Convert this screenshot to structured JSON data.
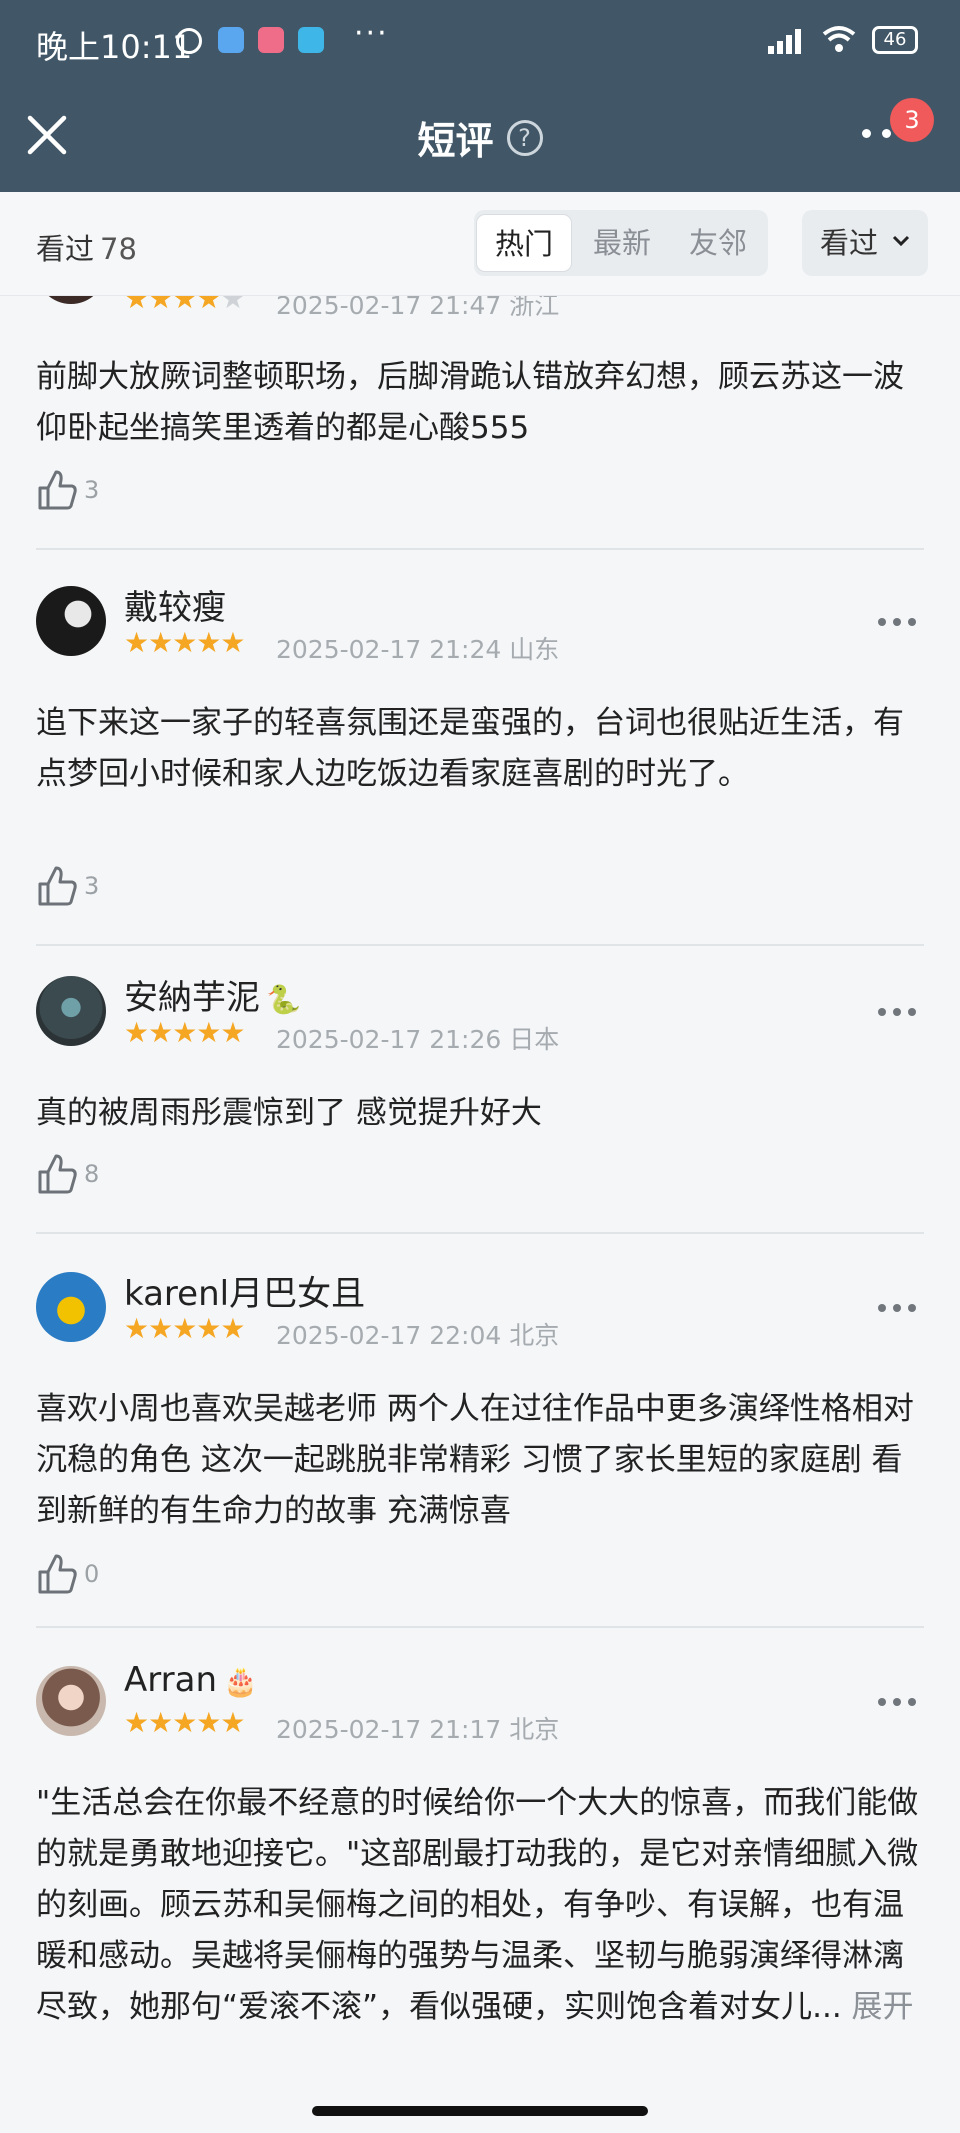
{
  "status": {
    "time": "晚上10:11",
    "dots": "···",
    "battery": "46"
  },
  "header": {
    "title": "短评",
    "help_label": "?",
    "badge_count": "3"
  },
  "filter": {
    "watched_label": "看过",
    "watched_count": "78",
    "tabs": [
      {
        "label": "热门",
        "active": true
      },
      {
        "label": "最新",
        "active": false
      },
      {
        "label": "友邻",
        "active": false
      }
    ],
    "dropdown_label": "看过"
  },
  "reviews": [
    {
      "user": "",
      "rating": 4,
      "stars": "★★★★",
      "stars_off": "★",
      "date": "2025-02-17 21:47",
      "location": "浙江",
      "content": "前脚大放厥词整顿职场，后脚滑跪认错放弃幻想，顾云苏这一波仰卧起坐搞笑里透着的都是心酸555",
      "likes": "3"
    },
    {
      "user": "戴较瘦",
      "rating": 5,
      "stars": "★★★★★",
      "date": "2025-02-17 21:24",
      "location": "山东",
      "content": "追下来这一家子的轻喜氛围还是蛮强的，台词也很贴近生活，有点梦回小时候和家人边吃饭边看家庭喜剧的时光了。",
      "likes": "3"
    },
    {
      "user": "安納芋泥",
      "decor": "🐍",
      "rating": 5,
      "stars": "★★★★★",
      "date": "2025-02-17 21:26",
      "location": "日本",
      "content": "真的被周雨彤震惊到了 感觉提升好大",
      "likes": "8"
    },
    {
      "user": "karenl月巴女且",
      "rating": 5,
      "stars": "★★★★★",
      "date": "2025-02-17 22:04",
      "location": "北京",
      "content": "喜欢小周也喜欢吴越老师 两个人在过往作品中更多演绎性格相对沉稳的角色 这次一起跳脱非常精彩 习惯了家长里短的家庭剧 看到新鲜的有生命力的故事 充满惊喜",
      "likes": "0"
    },
    {
      "user": "Arran",
      "decor": "🎂",
      "rating": 5,
      "stars": "★★★★★",
      "date": "2025-02-17 21:17",
      "location": "北京",
      "content": "\"生活总会在你最不经意的时候给你一个大大的惊喜，而我们能做的就是勇敢地迎接它。\"这部剧最打动我的，是它对亲情细腻入微的刻画。顾云苏和吴俪梅之间的相处，有争吵、有误解，也有温暖和感动。吴越将吴俪梅的强势与温柔、坚韧与脆弱演绎得淋漓尽致，她那句“爱滚不滚”，看似强硬，实则饱含着对女儿...",
      "expand": "展开"
    }
  ],
  "colors": {
    "header_bg": "#415767",
    "star": "#f5a623",
    "badge": "#f05a5a",
    "page_bg": "#f4f6f8"
  }
}
